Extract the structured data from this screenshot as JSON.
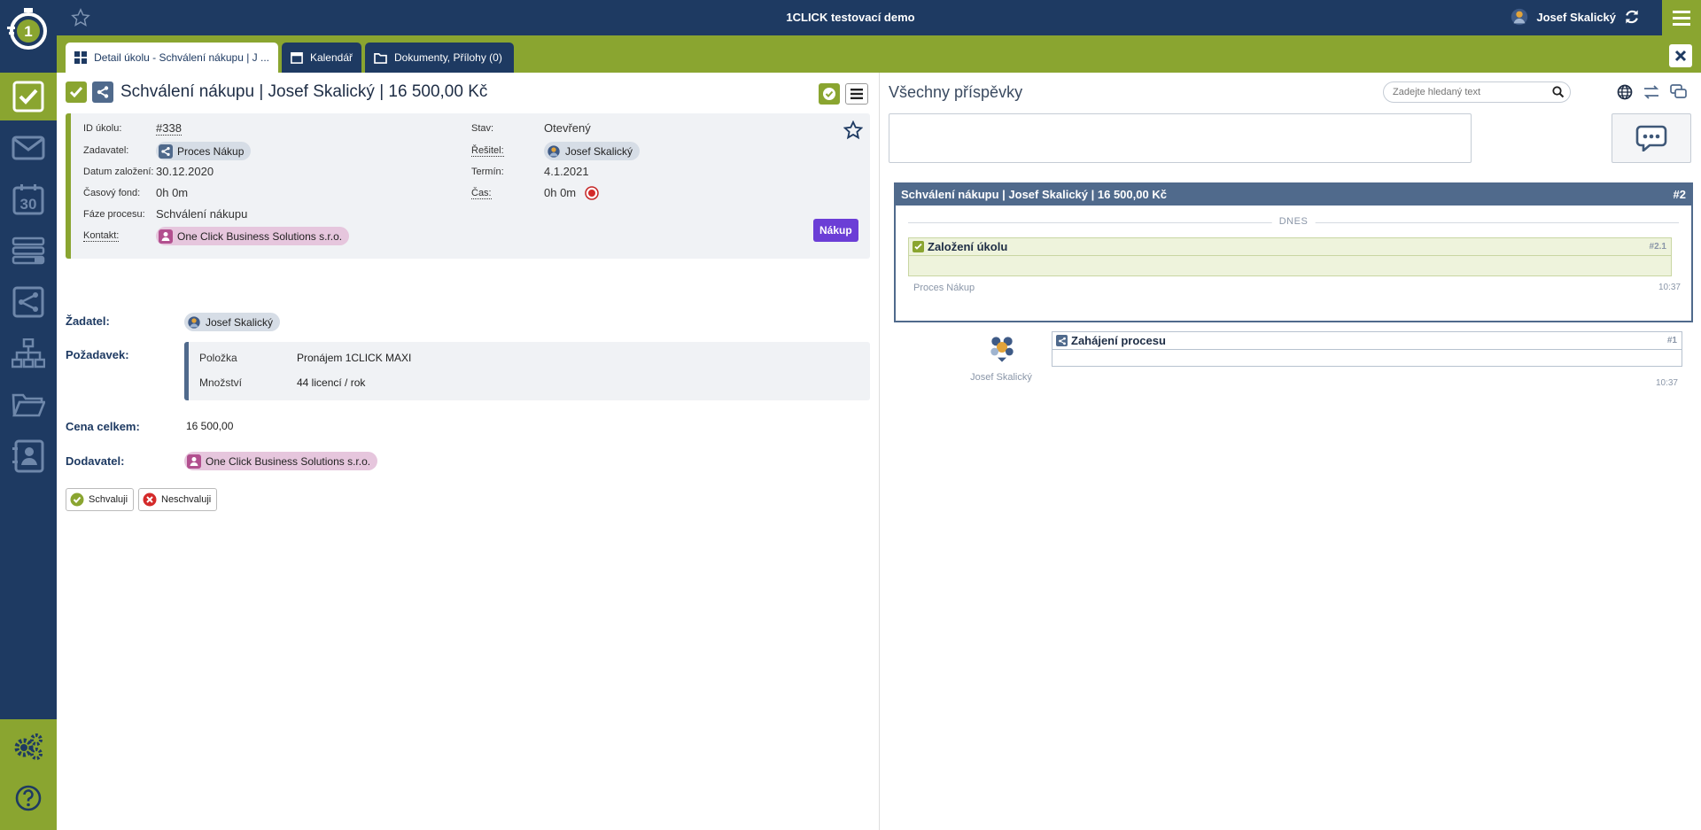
{
  "app": {
    "title": "1CLICK testovací demo",
    "user_name": "Josef Skalický"
  },
  "tabs": [
    {
      "label": "Detail úkolu - Schválení nákupu | J ...",
      "icon": "grid-icon",
      "active": true
    },
    {
      "label": "Kalendář",
      "icon": "calendar-icon",
      "active": false
    },
    {
      "label": "Dokumenty, Přílohy (0)",
      "icon": "folder-icon",
      "active": false
    }
  ],
  "sidebar": {
    "items": [
      {
        "name": "tasks",
        "icon": "check-icon",
        "active": true
      },
      {
        "name": "mail",
        "icon": "mail-icon"
      },
      {
        "name": "calendar",
        "icon": "calendar-30-icon",
        "day": "30"
      },
      {
        "name": "lists",
        "icon": "list-icon"
      },
      {
        "name": "processes",
        "icon": "process-icon"
      },
      {
        "name": "organization",
        "icon": "org-chart-icon"
      },
      {
        "name": "documents",
        "icon": "folder-icon"
      },
      {
        "name": "contacts",
        "icon": "contact-icon"
      }
    ],
    "bottom": [
      {
        "name": "settings",
        "icon": "gears-icon"
      },
      {
        "name": "help",
        "icon": "help-icon"
      }
    ]
  },
  "task": {
    "title": "Schválení nákupu | Josef Skalický | 16 500,00 Kč",
    "fields": {
      "id_label": "ID úkolu:",
      "id_value": "#338",
      "zadavatel_label": "Zadavatel:",
      "zadavatel_value": "Proces Nákup",
      "datum_label": "Datum založení:",
      "datum_value": "30.12.2020",
      "casovy_label": "Časový fond:",
      "casovy_value": "0h 0m",
      "faze_label": "Fáze procesu:",
      "faze_value": "Schválení nákupu",
      "kontakt_label": "Kontakt:",
      "kontakt_value": "One Click Business Solutions s.r.o.",
      "stav_label": "Stav:",
      "stav_value": "Otevřený",
      "resitel_label": "Řešitel:",
      "resitel_value": "Josef Skalický",
      "termin_label": "Termín:",
      "termin_value": "4.1.2021",
      "cas_label": "Čas:",
      "cas_value": "0h 0m"
    },
    "tag": "Nákup"
  },
  "form": {
    "zadatel_label": "Žadatel:",
    "zadatel_value": "Josef Skalický",
    "pozadavek_label": "Požadavek:",
    "pozadavek_rows": [
      {
        "label": "Položka",
        "value": "Pronájem 1CLICK MAXI"
      },
      {
        "label": "Množství",
        "value": "44 licencí / rok"
      }
    ],
    "cena_label": "Cena celkem:",
    "cena_value": "16 500,00",
    "dodavatel_label": "Dodavatel:",
    "dodavatel_value": "One Click Business Solutions s.r.o.",
    "approve_label": "Schvaluji",
    "reject_label": "Neschvaluji"
  },
  "posts": {
    "title": "Všechny příspěvky",
    "search_placeholder": "Zadejte hledaný text",
    "thread_title": "Schválení nákupu | Josef Skalický | 16 500,00 Kč",
    "thread_num": "#2",
    "divider_label": "DNES",
    "entry1_title": "Založení úkolu",
    "entry1_num": "#2.1",
    "entry1_author": "Proces Nákup",
    "entry1_time": "10:37",
    "entry2_title": "Zahájení procesu",
    "entry2_num": "#1",
    "entry2_author": "Josef Skalický",
    "entry2_time": "10:37"
  },
  "colors": {
    "navy": "#1e3a62",
    "olive": "#8aa530",
    "purple": "#6b3ed6",
    "red": "#d42a2a"
  }
}
